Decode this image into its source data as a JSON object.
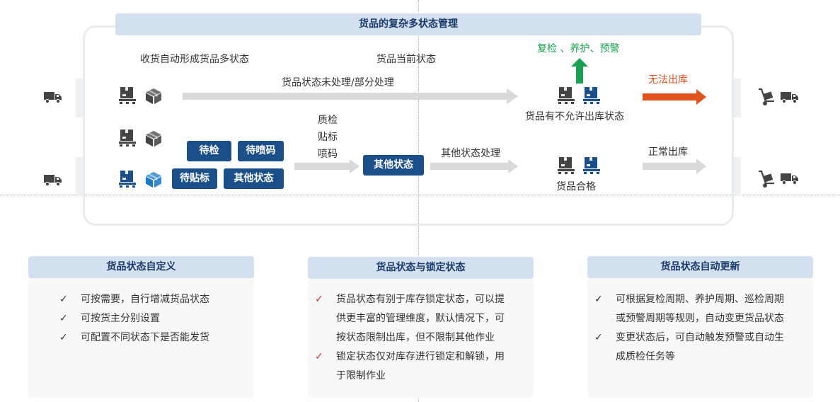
{
  "top": {
    "title": "货品的复杂多状态管理",
    "label_receive": "收货自动形成货品多状态",
    "label_current": "货品当前状态",
    "label_unprocessed": "货品状态未处理/部分处理",
    "label_recheck": "复检 、养护、预警",
    "label_no_ship": "无法出库",
    "label_not_allowed": "货品有不允许出库状态",
    "qc_lines": [
      "质检",
      "贴标",
      "喷码"
    ],
    "label_other_process": "其他状态处理",
    "label_normal_ship": "正常出库",
    "label_qualified": "货品合格",
    "pills": {
      "inspect": "待检",
      "spray": "待喷码",
      "label": "待贴标",
      "other": "其他状态",
      "other_mid": "其他状态"
    },
    "colors": {
      "green": "#1aa052",
      "orange": "#e0531e",
      "navy": "#1b4f8a",
      "gray_arrow": "#d9d9d9"
    }
  },
  "panels": [
    {
      "title": "货品状态自定义",
      "items": [
        "可按需要，自行增减货品状态",
        "可按货主分别设置",
        "可配置不同状态下是否能发货"
      ],
      "check_color": "#333333"
    },
    {
      "title": "货品状态与锁定状态",
      "items": [
        {
          "lines": [
            "货品状态有别于库存锁定状态，可以提",
            "供更丰富的管理维度，默认情况下，可",
            "按状态限制出库，但不限制其他作业"
          ]
        },
        {
          "lines": [
            "锁定状态仅对库存进行锁定和解锁，用",
            "于限制作业"
          ]
        }
      ],
      "check_color": "#c0392b"
    },
    {
      "title": "货品状态自动更新",
      "items": [
        {
          "lines": [
            "可根据复检周期、养护周期、巡检周期",
            "或预警周期等规则，自动变更货品状态"
          ]
        },
        {
          "lines": [
            "变更状态后，可自动触发预警或自动生",
            "成质检任务等"
          ]
        }
      ],
      "check_color": "#333333"
    }
  ],
  "icons": [
    "truck-icon",
    "hand-truck-icon",
    "pallet-box-icon",
    "cube-icon",
    "check-icon"
  ]
}
